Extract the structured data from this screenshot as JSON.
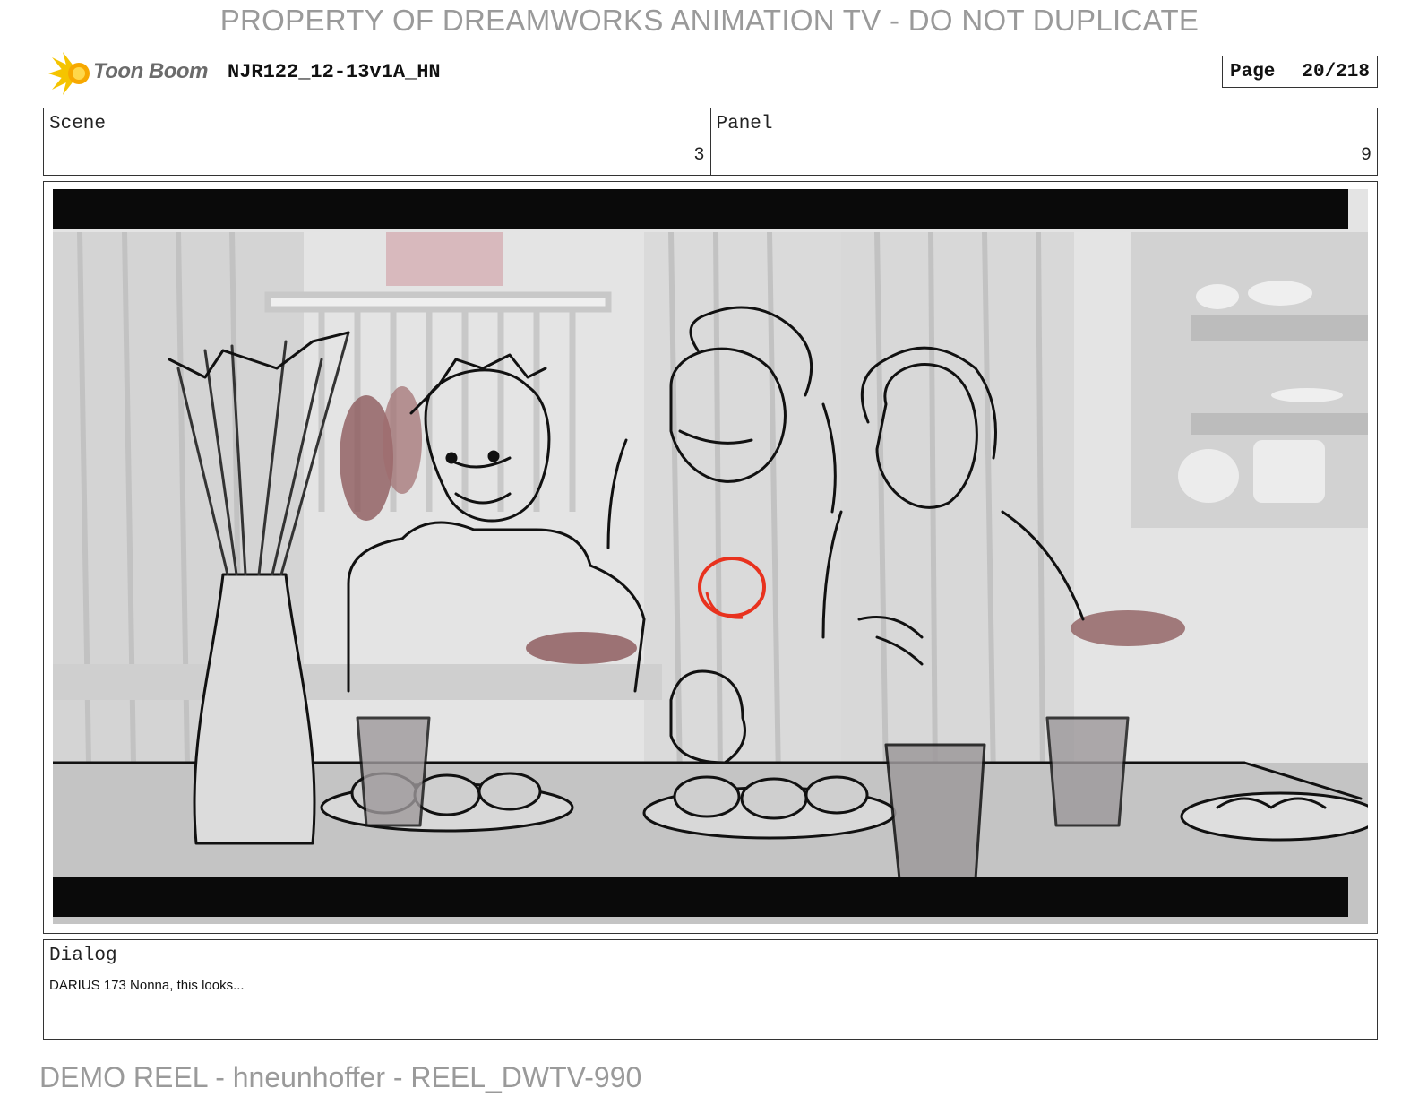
{
  "watermark": "PROPERTY OF DREAMWORKS ANIMATION TV - DO NOT DUPLICATE",
  "header": {
    "logo_text": "Toon Boom",
    "file_name": "NJR122_12-13v1A_HN",
    "page_label": "Page",
    "page_value": "20/218"
  },
  "info": {
    "scene_label": "Scene",
    "scene_value": "3",
    "panel_label": "Panel",
    "panel_value": "9"
  },
  "dialog": {
    "label": "Dialog",
    "text": "DARIUS 173 Nonna, this looks..."
  },
  "footer": "DEMO REEL - hneunhoffer - REEL_DWTV-990",
  "colors": {
    "logo_yellow": "#f5c400",
    "sketch_red": "#e8321e",
    "letterbox": "#0a0a0a",
    "watermark_gray": "#9a9a9a"
  }
}
